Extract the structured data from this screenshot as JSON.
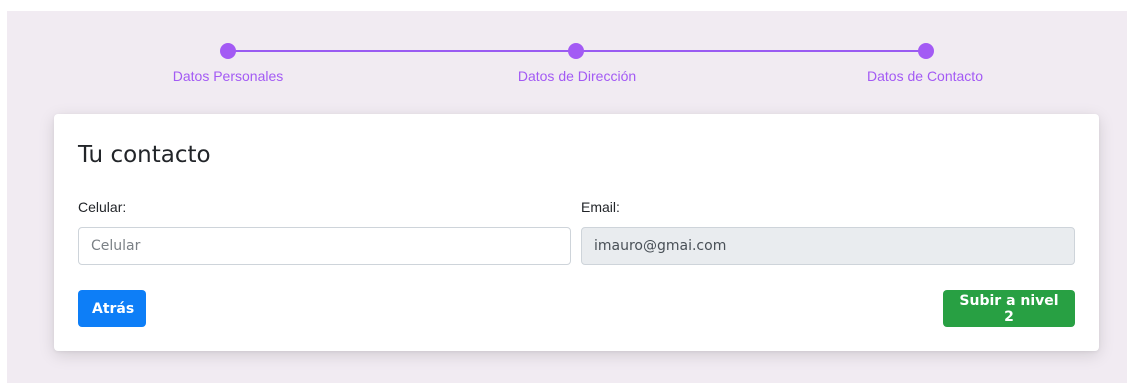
{
  "stepper": {
    "steps": [
      {
        "label": "Datos Personales"
      },
      {
        "label": "Datos de Dirección"
      },
      {
        "label": "Datos de Contacto"
      }
    ],
    "accent_color": "#a35af4"
  },
  "form": {
    "title": "Tu contacto",
    "celular": {
      "label": "Celular:",
      "placeholder": "Celular",
      "value": ""
    },
    "email": {
      "label": "Email:",
      "value": "imauro@gmai.com"
    }
  },
  "actions": {
    "back_label": "Atrás",
    "submit_label": "Subir a nivel 2",
    "back_color": "#0d7ef7",
    "submit_color": "#28a043"
  }
}
